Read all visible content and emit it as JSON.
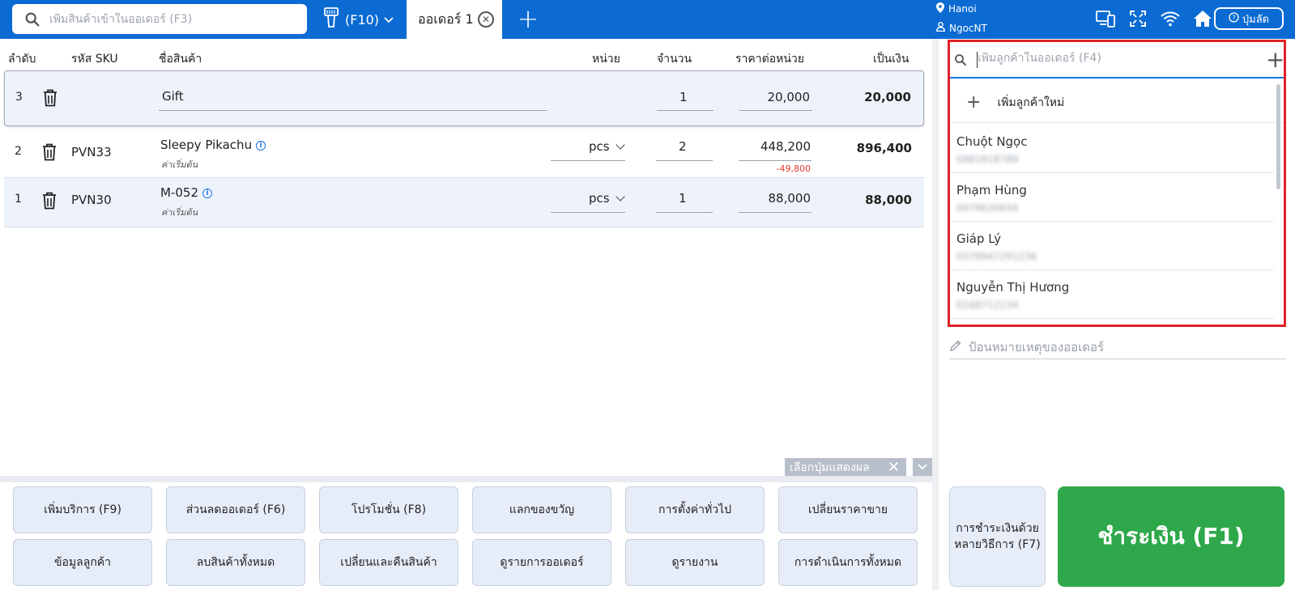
{
  "topbar": {
    "search_placeholder": "เพิ่มสินค้าเข้าในออเดอร์ (F3)",
    "scan_label": "(F10)",
    "active_tab": "ออเดอร์ 1",
    "location": "Hanoi",
    "user": "NgocNT",
    "shortcut_label": "ปุ่มลัด",
    "icons": [
      "search-icon",
      "barcode-scanner-icon",
      "close-circle-icon",
      "plus-icon",
      "location-pin-icon",
      "user-icon",
      "devices-icon",
      "fullscreen-icon",
      "wifi-icon",
      "home-icon",
      "help-icon"
    ]
  },
  "table": {
    "headers": {
      "index": "ลำดับ",
      "sku": "รหัส SKU",
      "name": "ชื่อสินค้า",
      "unit": "หน่วย",
      "qty": "จำนวน",
      "price": "ราคาต่อหน่วย",
      "total": "เป็นเงิน"
    },
    "rows": [
      {
        "index": "3",
        "sku": "",
        "name": "Gift",
        "sub": "",
        "unit": "",
        "qty": "1",
        "price": "20,000",
        "discount": "",
        "total": "20,000"
      },
      {
        "index": "2",
        "sku": "PVN33",
        "name": "Sleepy Pikachu",
        "sub": "ค่าเริ่มต้น",
        "unit": "pcs",
        "qty": "2",
        "price": "448,200",
        "discount": "-49,800",
        "total": "896,400"
      },
      {
        "index": "1",
        "sku": "PVN30",
        "name": "M-052",
        "sub": "ค่าเริ่มต้น",
        "unit": "pcs",
        "qty": "1",
        "price": "88,000",
        "discount": "",
        "total": "88,000"
      }
    ]
  },
  "display_options_label": "เลือกปุ่มแสดงผล",
  "actions": [
    "เพิ่มบริการ (F9)",
    "ส่วนลดออเดอร์ (F6)",
    "โปรโมชั่น (F8)",
    "แลกของขวัญ",
    "การตั้งค่าทั่วไป",
    "เปลี่ยนราคาขาย",
    "ข้อมูลลูกค้า",
    "ลบสินค้าทั้งหมด",
    "เปลี่ยนและคืนสินค้า",
    "ดูรายการออเดอร์",
    "ดูรายงาน",
    "การดำเนินการทั้งหมด"
  ],
  "customer": {
    "search_placeholder": "เพิ่มลูกค้าในออเดอร์ (F4)",
    "new_customer_label": "เพิ่มลูกค้าใหม่",
    "list": [
      {
        "name": "Chuột Ngọc",
        "phone": "0981818789"
      },
      {
        "name": "Phạm Hùng",
        "phone": "0979620656"
      },
      {
        "name": "Giáp Lý",
        "phone": "0378947291236"
      },
      {
        "name": "Nguyễn Thị Hương",
        "phone": "0168712234"
      }
    ]
  },
  "note_placeholder": "ป้อนหมายเหตุของออเดอร์",
  "payment": {
    "multi_label": "การชำระเงินด้วยหลายวิธีการ (F7)",
    "pay_label": "ชำระเงิน (F1)"
  },
  "colors": {
    "brand_blue": "#0b6bd3",
    "pay_green": "#2ea84a",
    "highlight_red": "#e0202a",
    "discount_red": "#e53935"
  }
}
